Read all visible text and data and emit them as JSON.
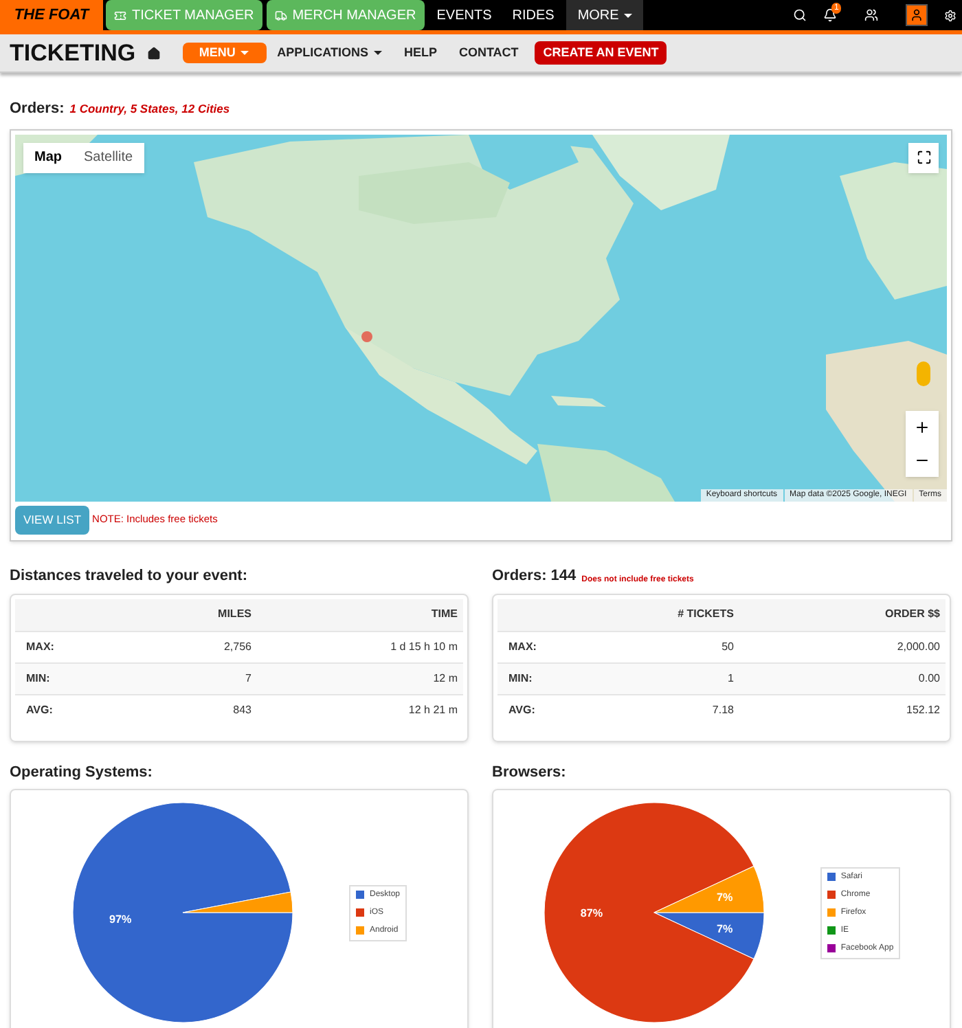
{
  "top_nav": {
    "logo": "THE FOAT",
    "items": [
      {
        "label": "TICKET MANAGER",
        "kind": "green"
      },
      {
        "label": "MERCH MANAGER",
        "kind": "green"
      },
      {
        "label": "EVENTS",
        "kind": "link"
      },
      {
        "label": "RIDES",
        "kind": "link"
      },
      {
        "label": "MORE",
        "kind": "dropdown"
      }
    ],
    "notification_count": "1"
  },
  "sub_nav": {
    "title": "TICKETING",
    "items": [
      {
        "label": "MENU",
        "kind": "primary"
      },
      {
        "label": "APPLICATIONS",
        "kind": "dropdown"
      },
      {
        "label": "HELP",
        "kind": "link"
      },
      {
        "label": "CONTACT",
        "kind": "link"
      },
      {
        "label": "CREATE AN EVENT",
        "kind": "danger"
      }
    ]
  },
  "orders_summary": {
    "label": "Orders:",
    "detail": "1 Country, 5 States, 12 Cities"
  },
  "map": {
    "tabs": [
      {
        "label": "Map",
        "selected": true
      },
      {
        "label": "Satellite",
        "selected": false
      }
    ],
    "attribution": [
      "Keyboard shortcuts",
      "Map data ©2025 Google, INEGI",
      "Terms"
    ],
    "button": "VIEW LIST",
    "note": "NOTE: Includes free tickets"
  },
  "tables": [
    {
      "title": "Distances traveled to your event:",
      "columns": [
        "MILES",
        "TIME"
      ],
      "rows": [
        {
          "label": "MAX:",
          "values": [
            "2,756",
            "1 d 15 h 10 m"
          ]
        },
        {
          "label": "MIN:",
          "values": [
            "7",
            "12 m"
          ]
        },
        {
          "label": "AVG:",
          "values": [
            "843",
            "12 h 21 m"
          ]
        }
      ]
    },
    {
      "title": "Orders: 144",
      "note": "Does not include free tickets",
      "columns": [
        "# TICKETS",
        "ORDER $$"
      ],
      "rows": [
        {
          "label": "MAX:",
          "values": [
            "50",
            "2,000.00"
          ]
        },
        {
          "label": "MIN:",
          "values": [
            "1",
            "0.00"
          ]
        },
        {
          "label": "AVG:",
          "values": [
            "7.18",
            "152.12"
          ]
        }
      ]
    }
  ],
  "charts": [
    {
      "title": "Operating Systems:",
      "chart_data": {
        "type": "pie",
        "categories": [
          "Desktop",
          "iOS",
          "Android"
        ],
        "series": [
          {
            "values": [
              97,
              0,
              3
            ]
          }
        ],
        "value_labels": [
          "97%",
          null,
          null
        ],
        "legend": "right"
      }
    },
    {
      "title": "Browsers:",
      "chart_data": {
        "type": "pie",
        "categories": [
          "Safari",
          "Chrome",
          "Firefox",
          "IE",
          "Facebook App"
        ],
        "series": [
          {
            "values": [
              7,
              87,
              7,
              0,
              0
            ]
          }
        ],
        "value_labels": [
          "7%",
          "87%",
          "7%",
          null,
          null
        ],
        "legend": "right"
      }
    }
  ]
}
